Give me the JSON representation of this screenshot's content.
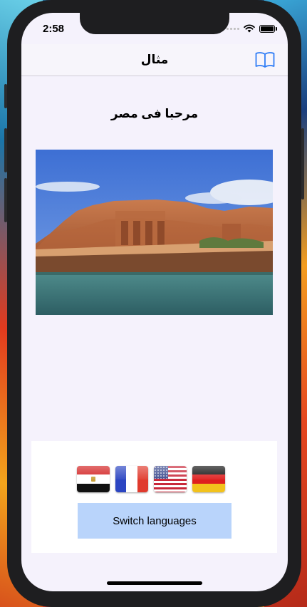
{
  "status_bar": {
    "time": "2:58"
  },
  "navbar": {
    "title": "مثال",
    "book_icon": "book-icon"
  },
  "main": {
    "headline": "مرحبا فى مصر",
    "photo": "abu-simbel-temple-photo"
  },
  "language_card": {
    "flags": [
      {
        "name": "Egypt",
        "icon": "egypt-flag-icon"
      },
      {
        "name": "France",
        "icon": "france-flag-icon"
      },
      {
        "name": "United States",
        "icon": "usa-flag-icon"
      },
      {
        "name": "Germany",
        "icon": "germany-flag-icon"
      }
    ],
    "switch_label": "Switch languages"
  },
  "colors": {
    "tint": "#2f7df6",
    "button_bg": "#b9d4fb",
    "screen_bg": "#f5f2fc"
  }
}
